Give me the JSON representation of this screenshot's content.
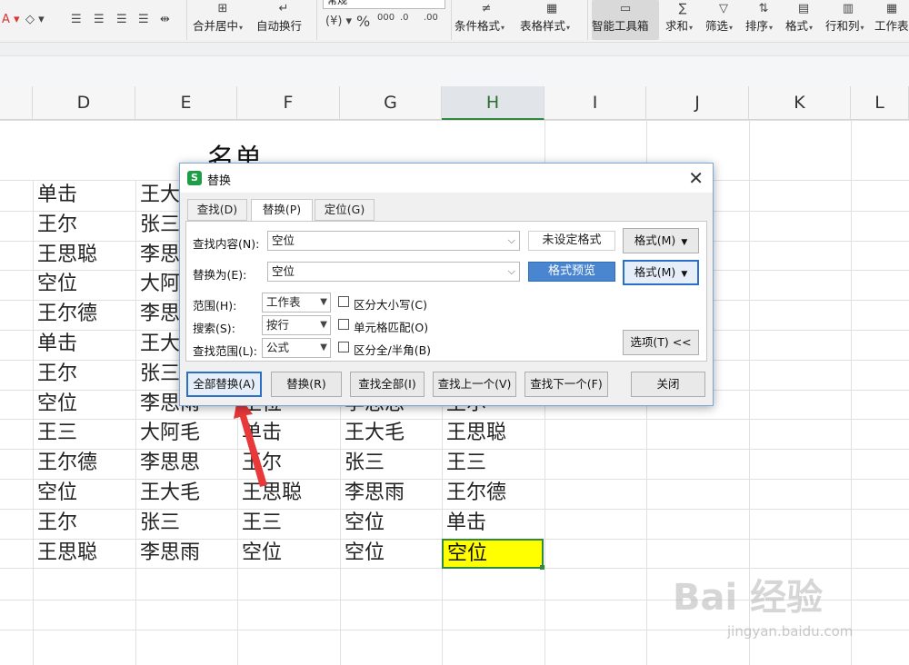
{
  "ribbon": {
    "merge_center": "合并居中",
    "wrap_text": "自动换行",
    "number_format": "常规",
    "percent": "%",
    "thousands": "000",
    "conditional_format": "条件格式",
    "table_style": "表格样式",
    "smart_toolbox": "智能工具箱",
    "sum": "求和",
    "filter": "筛选",
    "sort": "排序",
    "format": "格式",
    "rows_cols": "行和列",
    "worksheet": "工作表"
  },
  "columns": [
    "D",
    "E",
    "F",
    "G",
    "H",
    "I",
    "J",
    "K",
    "L"
  ],
  "selected_column": "H",
  "sheet_title": "名单",
  "rows": [
    [
      "单击",
      "王大毛",
      "",
      "",
      ""
    ],
    [
      "王尔",
      "张三",
      "",
      "",
      ""
    ],
    [
      "王思聪",
      "李思思",
      "",
      "",
      ""
    ],
    [
      "空位",
      "大阿毛",
      "",
      "",
      ""
    ],
    [
      "王尔德",
      "李思思",
      "",
      "",
      ""
    ],
    [
      "单击",
      "王大毛",
      "",
      "",
      ""
    ],
    [
      "王尔",
      "张三",
      "",
      "",
      ""
    ],
    [
      "空位",
      "李思雨",
      "王位",
      "李思思",
      "王尔"
    ],
    [
      "王三",
      "大阿毛",
      "单击",
      "王大毛",
      "王思聪"
    ],
    [
      "王尔德",
      "李思思",
      "王尔",
      "张三",
      "王三"
    ],
    [
      "空位",
      "王大毛",
      "王思聪",
      "李思雨",
      "王尔德"
    ],
    [
      "王尔",
      "张三",
      "王三",
      "空位",
      "单击"
    ],
    [
      "王思聪",
      "李思雨",
      "空位",
      "空位",
      "空位"
    ]
  ],
  "dialog": {
    "title": "替换",
    "tabs": [
      "查找(D)",
      "替换(P)",
      "定位(G)"
    ],
    "find_label": "查找内容(N):",
    "find_value": "空位",
    "replace_label": "替换为(E):",
    "replace_value": "空位",
    "no_format": "未设定格式",
    "format_preview": "格式预览",
    "format_btn": "格式(M)",
    "scope_label": "范围(H):",
    "scope_value": "工作表",
    "search_label": "搜索(S):",
    "search_value": "按行",
    "lookin_label": "查找范围(L):",
    "lookin_value": "公式",
    "match_case": "区分大小写(C)",
    "match_cell": "单元格匹配(O)",
    "match_width": "区分全/半角(B)",
    "options_btn": "选项(T) <<",
    "replace_all": "全部替换(A)",
    "replace": "替换(R)",
    "find_all": "查找全部(I)",
    "find_prev": "查找上一个(V)",
    "find_next": "查找下一个(F)",
    "close": "关闭"
  },
  "watermark": "Bai 经验",
  "watermark_sub": "jingyan.baidu.com",
  "colors": {
    "accent_green": "#2f8a3f",
    "highlight_yellow": "#ffff00",
    "arrow_red": "#e8383a"
  }
}
